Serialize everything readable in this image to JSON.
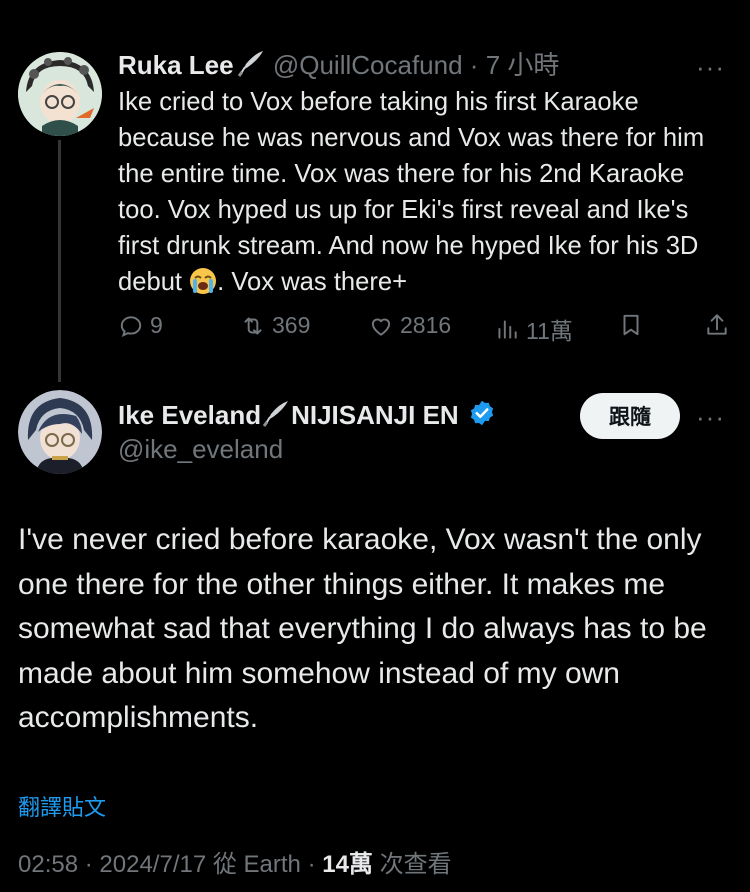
{
  "reply": {
    "author_name": "Ruka Lee",
    "author_handle": "@QuillCocafund",
    "separator": "·",
    "time": "7 小時",
    "text_before_emoji": "Ike cried to Vox before taking his first Karaoke because he was nervous and Vox was there for him the entire time. Vox was there for his 2nd Karaoke too. Vox hyped us up for Eki's first reveal and Ike's first drunk stream. And now he hyped Ike for his 3D debut ",
    "text_after_emoji": ". Vox was there+",
    "emoji_icon": "loudly-crying-face-icon",
    "replies": "9",
    "reposts": "369",
    "likes": "2816",
    "views": "11萬"
  },
  "main": {
    "author_name": "Ike Eveland",
    "author_suffix": "NIJISANJI EN",
    "author_handle": "@ike_eveland",
    "verified": true,
    "follow_label": "跟隨",
    "text": "I've never cried before karaoke, Vox wasn't the only one there for the other things either. It makes me somewhat sad that everything I do always has to be made about him somehow instead of my own accomplishments.",
    "translate_label": "翻譯貼文",
    "time": "02:58",
    "date": "2024/7/17",
    "source": "從 Earth",
    "views_count": "14萬",
    "views_label": "次查看"
  },
  "colors": {
    "background": "#000000",
    "text": "#e7e9ea",
    "muted": "#71767b",
    "link": "#1d9bf0",
    "verified": "#1d9bf0",
    "follow_bg": "#eff3f4"
  }
}
